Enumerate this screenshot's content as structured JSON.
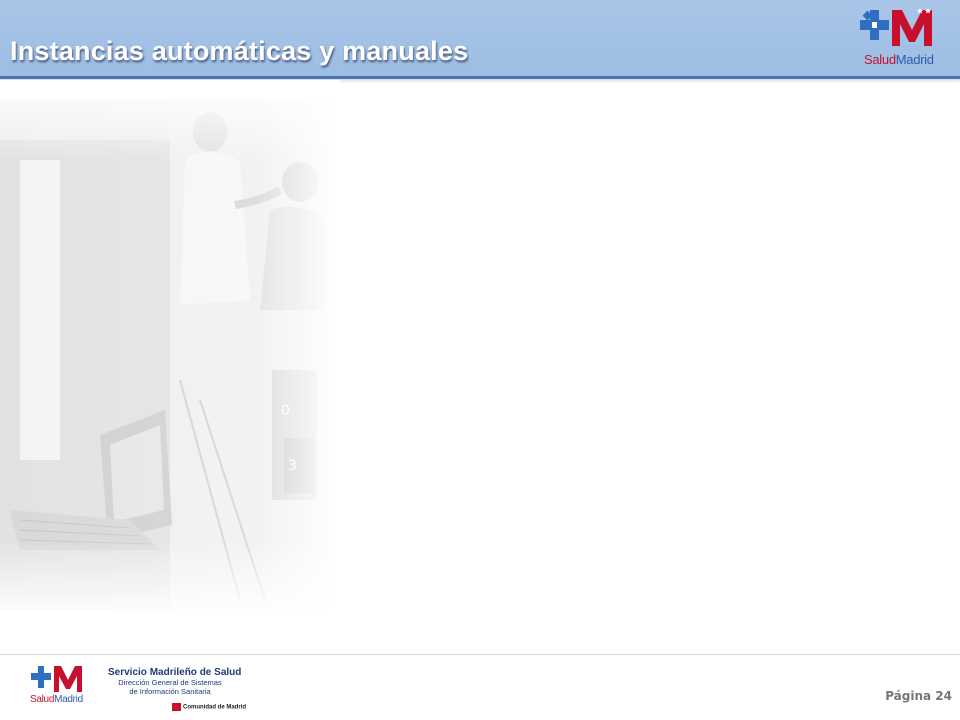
{
  "header": {
    "title": "Instancias automáticas y manuales",
    "logo": {
      "brand_salud": "Salud",
      "brand_madrid": "Madrid",
      "icon": "salud-madrid-cross-m-logo"
    }
  },
  "colors": {
    "header_bg": "#a9c6e8",
    "header_border": "#4a74b4",
    "brand_red": "#c8102e",
    "brand_blue": "#2e5aa8",
    "org_blue": "#1f3a7a"
  },
  "footer": {
    "logo": {
      "brand_salud": "Salud",
      "brand_madrid": "Madrid",
      "icon": "salud-madrid-cross-m-logo"
    },
    "org_name": "Servicio Madrileño de Salud",
    "org_sub_1": "Dirección General de Sistemas",
    "org_sub_2": "de Información Sanitaria",
    "comunidad": "Comunidad de Madrid",
    "page_label": "Página 24"
  }
}
